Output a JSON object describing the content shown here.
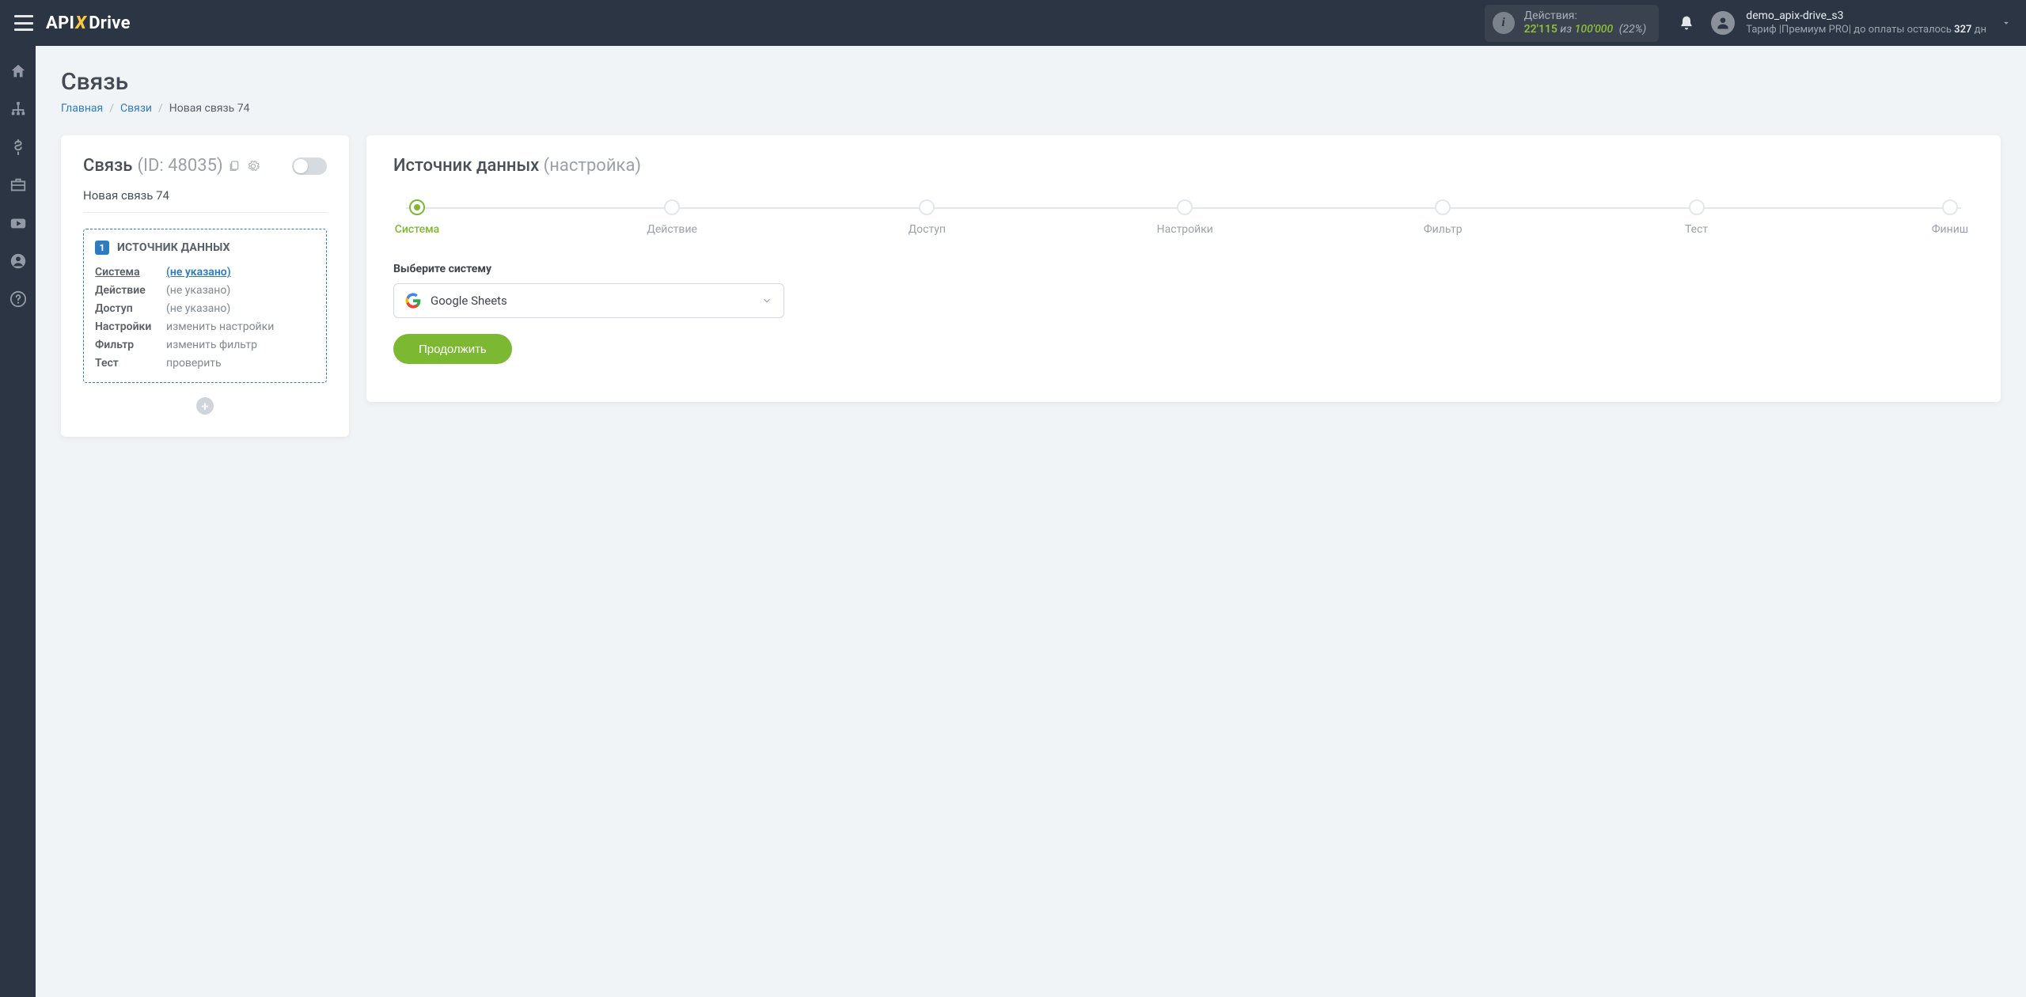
{
  "logo": {
    "part1": "API",
    "part2": "X",
    "part3": "Drive"
  },
  "stats": {
    "label": "Действия:",
    "used": "22'115",
    "of": "из",
    "total": "100'000",
    "percent": "(22%)"
  },
  "user": {
    "name": "demo_apix-drive_s3",
    "plan_prefix": "Тариф |Премиум PRO| до оплаты осталось ",
    "days": "327",
    "days_suffix": " дн"
  },
  "page": {
    "title": "Связь"
  },
  "breadcrumb": {
    "home": "Главная",
    "connections": "Связи",
    "current": "Новая связь 74"
  },
  "leftCard": {
    "title": "Связь",
    "id_label": "(ID: 48035)",
    "name": "Новая связь 74",
    "source_badge": "1",
    "source_title": "ИСТОЧНИК ДАННЫХ",
    "rows": [
      {
        "label": "Система",
        "value": "(не указано)",
        "link": true,
        "active": true
      },
      {
        "label": "Действие",
        "value": "(не указано)"
      },
      {
        "label": "Доступ",
        "value": "(не указано)"
      },
      {
        "label": "Настройки",
        "value": "изменить настройки"
      },
      {
        "label": "Фильтр",
        "value": "изменить фильтр"
      },
      {
        "label": "Тест",
        "value": "проверить"
      }
    ]
  },
  "rightCard": {
    "title": "Источник данных",
    "subtitle": "(настройка)",
    "steps": [
      "Система",
      "Действие",
      "Доступ",
      "Настройки",
      "Фильтр",
      "Тест",
      "Финиш"
    ],
    "field_label": "Выберите систему",
    "selected_system": "Google Sheets",
    "continue": "Продолжить"
  }
}
